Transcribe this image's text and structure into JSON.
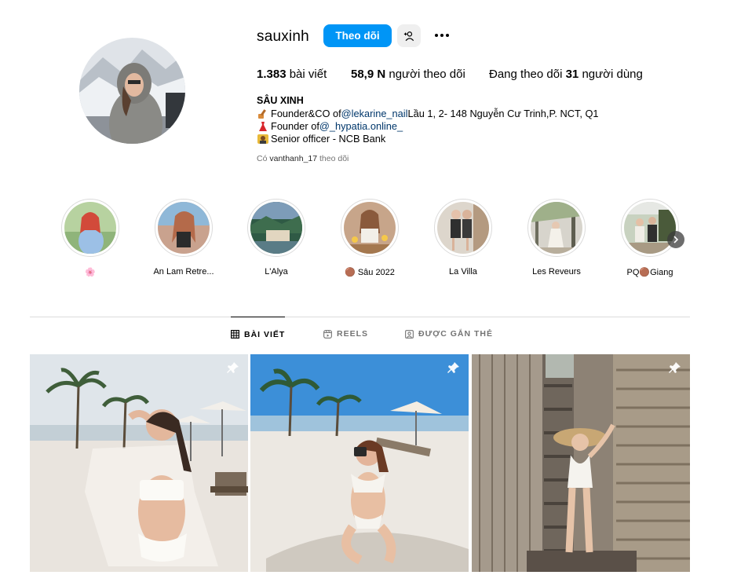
{
  "profile": {
    "username": "sauxinh",
    "follow_label": "Theo dõi",
    "full_name": "SÂU XINH",
    "stats": {
      "posts_count": "1.383",
      "posts_label": "bài viết",
      "followers_count": "58,9 N",
      "followers_label": "người theo dõi",
      "following_prefix": "Đang theo dõi",
      "following_count": "31",
      "following_label": "người dùng"
    },
    "bio": {
      "line1_text": "Founder&CO of ",
      "line1_mention": "@lekarine_nail",
      "line1_rest": " Lầu 1, 2- 148 Nguyễn Cư Trinh,P. NCT, Q1",
      "line2_text": "Founder of ",
      "line2_mention": "@_hypatia.online_",
      "line3_text": "Senior officer - NCB Bank"
    },
    "followed_by_prefix": "Có",
    "followed_by_user": "vanthanh_17",
    "followed_by_suffix": "theo dõi"
  },
  "highlights": [
    {
      "label": "🌸",
      "icon": "flower-emoji"
    },
    {
      "label": "An Lam Retre..."
    },
    {
      "label": "L'Alya"
    },
    {
      "label": "🟤 Sâu 2022"
    },
    {
      "label": "La Villa"
    },
    {
      "label": "Les Reveurs"
    },
    {
      "label": "PQ🟤Giang"
    }
  ],
  "tabs": [
    {
      "label": "BÀI VIẾT",
      "icon": "grid-icon",
      "active": true
    },
    {
      "label": "REELS",
      "icon": "reels-icon",
      "active": false
    },
    {
      "label": "ĐƯỢC GẮN THẺ",
      "icon": "tagged-icon",
      "active": false
    }
  ],
  "posts": [
    {
      "pinned": true,
      "scene": "beach-white-outfit"
    },
    {
      "pinned": true,
      "scene": "beach-camera"
    },
    {
      "pinned": true,
      "scene": "wooden-corridor-hat"
    }
  ],
  "colors": {
    "accent": "#0095f6",
    "mention": "#00376b",
    "muted": "#737373"
  }
}
